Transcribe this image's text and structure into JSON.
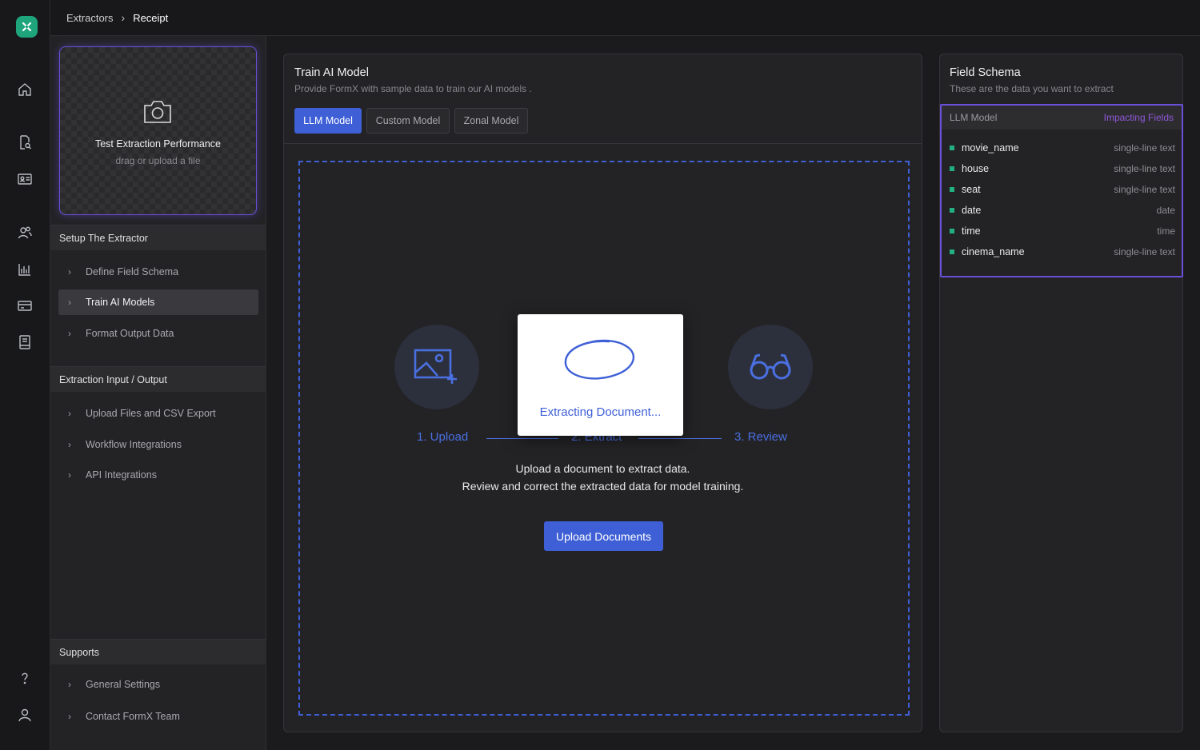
{
  "breadcrumb": {
    "parent": "Extractors",
    "current": "Receipt"
  },
  "rail": {
    "icons": [
      "home-icon",
      "document-search-icon",
      "id-card-icon",
      "users-icon",
      "chart-icon",
      "credit-card-icon",
      "book-icon",
      "help-icon",
      "user-icon"
    ]
  },
  "sidebar": {
    "upload": {
      "title": "Test Extraction Performance",
      "subtitle": "drag or upload a file"
    },
    "sections": [
      {
        "title": "Setup The Extractor",
        "items": [
          "Define Field Schema",
          "Train AI Models",
          "Format Output Data"
        ],
        "active": "Train AI Models"
      },
      {
        "title": "Extraction Input / Output",
        "items": [
          "Upload Files and CSV Export",
          "Workflow Integrations",
          "API Integrations"
        ]
      },
      {
        "title": "Supports",
        "items": [
          "General Settings",
          "Contact FormX Team"
        ]
      }
    ]
  },
  "main": {
    "title": "Train AI Model",
    "subtitle": "Provide FormX with sample data to train our AI models .",
    "tabs": [
      "LLM Model",
      "Custom Model",
      "Zonal Model"
    ],
    "active_tab": "LLM Model",
    "steps": [
      "1. Upload",
      "2. Extract",
      "3. Review"
    ],
    "desc_line1": "Upload a document to extract data.",
    "desc_line2": "Review and correct the extracted data for model training.",
    "upload_button": "Upload Documents",
    "modal_text": "Extracting Document..."
  },
  "schema": {
    "title": "Field Schema",
    "subtitle": "These are the data you want to extract",
    "model_label": "LLM Model",
    "impacting_label": "Impacting Fields",
    "fields": [
      {
        "name": "movie_name",
        "type": "single-line text"
      },
      {
        "name": "house",
        "type": "single-line text"
      },
      {
        "name": "seat",
        "type": "single-line text"
      },
      {
        "name": "date",
        "type": "date"
      },
      {
        "name": "time",
        "type": "time"
      },
      {
        "name": "cinema_name",
        "type": "single-line text"
      }
    ]
  },
  "colors": {
    "accent": "#3e5fd6",
    "purple": "#6a4fd8",
    "brand": "#1fa57b",
    "field_dot": "#22b07e"
  }
}
